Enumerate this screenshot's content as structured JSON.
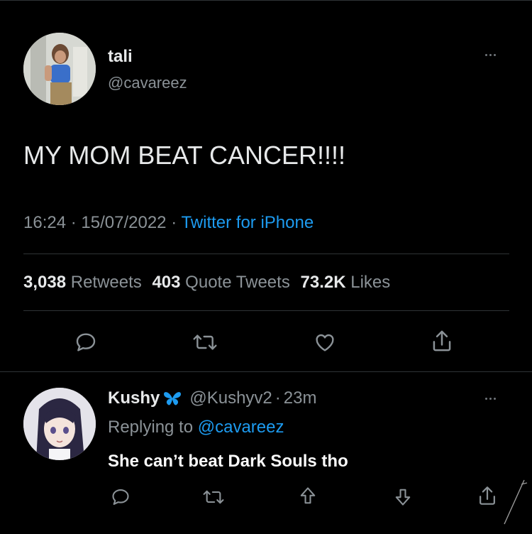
{
  "tweet": {
    "display_name": "tali",
    "handle": "@cavareez",
    "text": "MY MOM BEAT CANCER!!!!",
    "time": "16:24",
    "date": "15/07/2022",
    "sep1": "·",
    "sep2": "·",
    "source": "Twitter for iPhone",
    "stats": {
      "retweets_count": "3,038",
      "retweets_label": "Retweets",
      "quotes_count": "403",
      "quotes_label": "Quote Tweets",
      "likes_count": "73.2K",
      "likes_label": "Likes"
    }
  },
  "reply": {
    "display_name": "Kushy",
    "badge_icon": "butterfly-icon",
    "handle": "@Kushyv2",
    "sep": "·",
    "time": "23m",
    "replying_prefix": "Replying to",
    "replying_handle": "@cavareez",
    "text": "She can’t beat Dark Souls tho"
  },
  "colors": {
    "background": "#000000",
    "text": "#e7e9ea",
    "secondary": "#8b9297",
    "link": "#1d9bf0",
    "divider": "#2f3336",
    "badge": "#1d9bf0"
  }
}
